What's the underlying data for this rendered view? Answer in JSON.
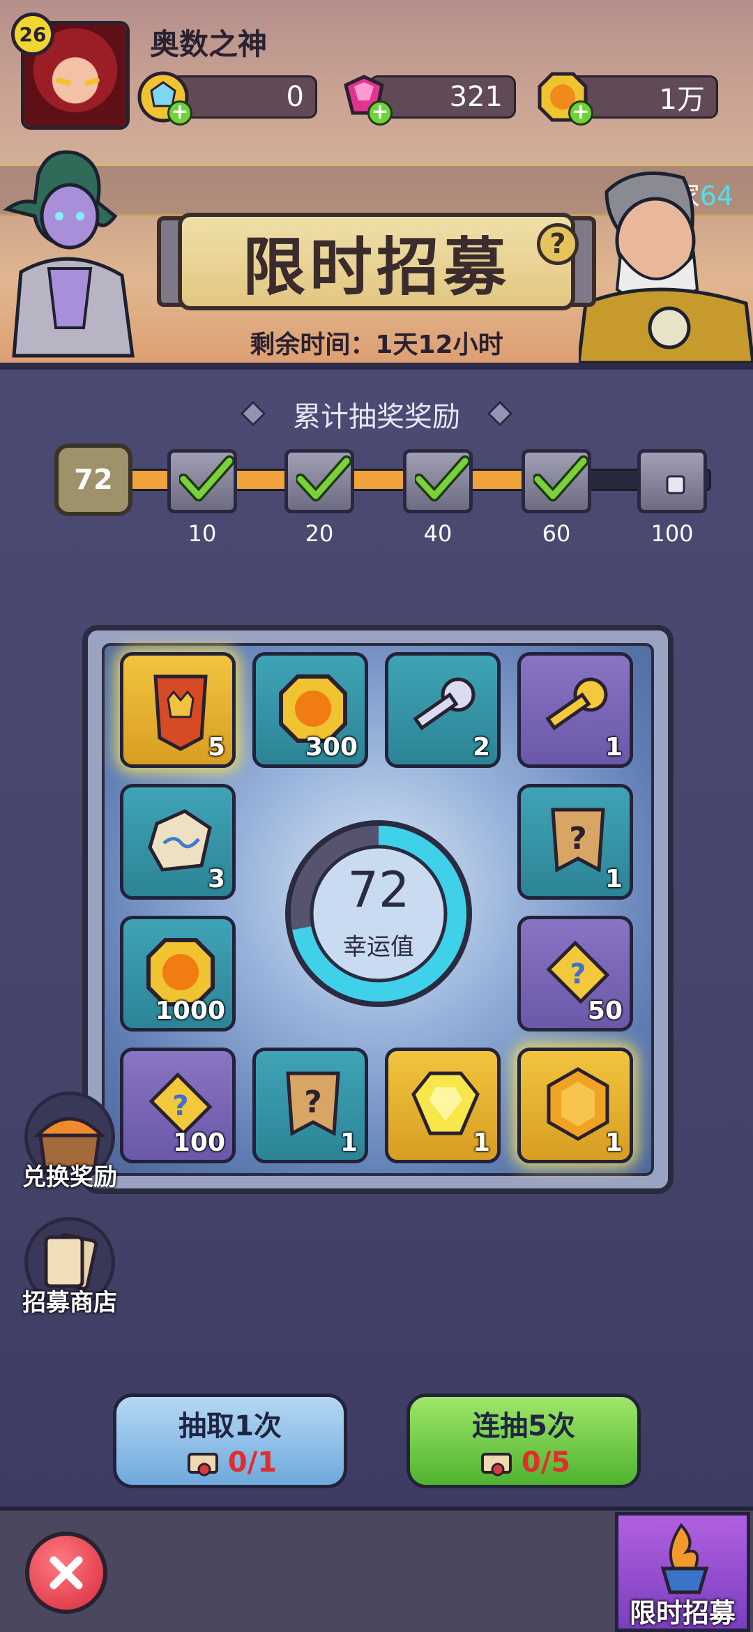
{
  "player": {
    "level": "26",
    "name": "奥数之神"
  },
  "resources": [
    {
      "name": "blue-coin",
      "value": "0",
      "color": "#f0c330"
    },
    {
      "name": "pink-gem",
      "value": "321",
      "color": "#e4338f"
    },
    {
      "name": "gold-coin",
      "value": "1万",
      "color": "#f3a321"
    }
  ],
  "banner": {
    "player_tag_prefix": "玩家",
    "player_tag_id": "64",
    "title": "限时招募",
    "help": "?",
    "remaining": "剩余时间：1天12小时"
  },
  "cumulative": {
    "title": "累计抽奖奖励",
    "current": "72",
    "progress_fraction": 0.72,
    "milestones": [
      {
        "label": "10",
        "claimed": true
      },
      {
        "label": "20",
        "claimed": true
      },
      {
        "label": "40",
        "claimed": true
      },
      {
        "label": "60",
        "claimed": true
      },
      {
        "label": "100",
        "claimed": false
      }
    ]
  },
  "board": {
    "tiles": [
      {
        "item": "rank-card",
        "count": "5",
        "style": "gold"
      },
      {
        "item": "gold-coin",
        "count": "300",
        "style": "blue"
      },
      {
        "item": "silver-key",
        "count": "2",
        "style": "blue"
      },
      {
        "item": "gold-key",
        "count": "1",
        "style": "purple"
      },
      {
        "item": "rune-stone",
        "count": "3",
        "style": "blue"
      },
      {
        "item": "mystery-banner",
        "count": "1",
        "style": "blue"
      },
      {
        "item": "gold-coin",
        "count": "1000",
        "style": "blue"
      },
      {
        "item": "mystery-puzzle",
        "count": "50",
        "style": "purple"
      },
      {
        "item": "mystery-puzzle",
        "count": "100",
        "style": "purple"
      },
      {
        "item": "mystery-banner",
        "count": "1",
        "style": "blue"
      },
      {
        "item": "yellow-gem",
        "count": "1",
        "style": "gold"
      },
      {
        "item": "orange-gem",
        "count": "1",
        "style": "gold"
      }
    ],
    "luck_value": "72",
    "luck_label": "幸运值",
    "luck_fraction": 0.72
  },
  "side": {
    "exchange": "兑换奖励",
    "shop": "招募商店"
  },
  "draw": {
    "once_label": "抽取1次",
    "once_cost": "0/1",
    "five_label": "连抽5次",
    "five_cost": "0/5"
  },
  "bottom": {
    "recruit_tab": "限时招募"
  }
}
